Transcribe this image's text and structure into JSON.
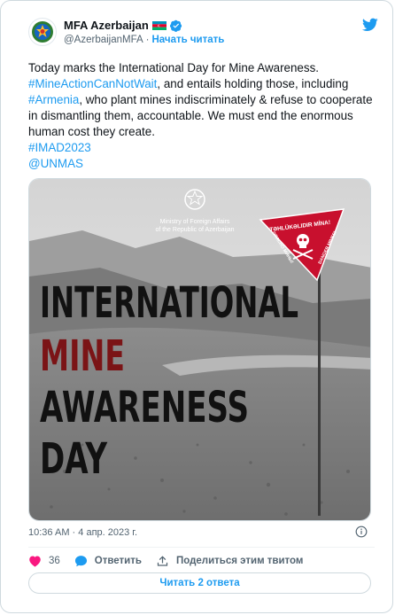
{
  "account": {
    "name": "MFA Azerbaijan",
    "handle": "@AzerbaijanMFA",
    "separator": "·",
    "follow_label": "Начать читать"
  },
  "tweet": {
    "t1": "Today marks the International Day for Mine Awareness. ",
    "h1": "#MineActionCanNotWait",
    "t2": ", and entails holding those, including ",
    "h2": "#Armenia",
    "t3": ", who plant mines indiscriminately & refuse to cooperate in dismantling them, accountable. We must end the enormous human cost they create.",
    "h3": "#IMAD2023",
    "h4": "@UNMAS"
  },
  "media": {
    "ministry_line1": "Ministry of Foreign Affairs",
    "ministry_line2": "of the Republic of Azerbaijan",
    "sign_top": "TƏHLÜKƏLIDIR MİNA!",
    "sign_left": "ОПАСНО МИНЫ!",
    "sign_right": "DANGER MINES!",
    "line1": "INTERNATIONAL",
    "line2": "MINE",
    "line3": "AWARENESS",
    "line4": "DAY",
    "accent_color": "#7b1416"
  },
  "meta": {
    "time": "10:36 AM",
    "separator": "·",
    "date": "4 апр. 2023 г."
  },
  "actions": {
    "likes_count": "36",
    "reply_label": "Ответить",
    "share_label": "Поделиться этим твитом"
  },
  "replies_button": "Читать 2 ответа",
  "colors": {
    "link": "#1d9bf0",
    "like": "#f91880",
    "text": "#0f1419",
    "muted": "#536471"
  }
}
